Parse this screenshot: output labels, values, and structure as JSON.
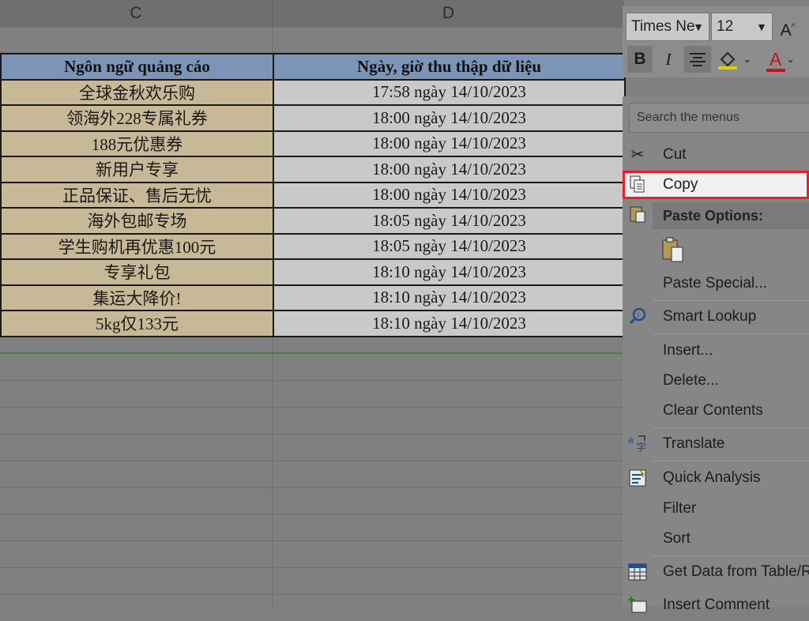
{
  "sheet": {
    "columns": [
      "C",
      "D"
    ],
    "header": [
      "Ngôn ngữ quảng cáo",
      "Ngày, giờ thu thập dữ liệu"
    ],
    "rows": [
      [
        "全球金秋欢乐购",
        "17:58 ngày 14/10/2023"
      ],
      [
        "领海外228专属礼券",
        "18:00 ngày 14/10/2023"
      ],
      [
        "188元优惠券",
        "18:00 ngày 14/10/2023"
      ],
      [
        "新用户专享",
        "18:00 ngày 14/10/2023"
      ],
      [
        "正品保证、售后无忧",
        "18:00 ngày 14/10/2023"
      ],
      [
        "海外包邮专场",
        "18:05 ngày 14/10/2023"
      ],
      [
        "学生购机再优惠100元",
        "18:05 ngày 14/10/2023"
      ],
      [
        "专享礼包",
        "18:10 ngày 14/10/2023"
      ],
      [
        "集运大降价!",
        "18:10 ngày 14/10/2023"
      ],
      [
        "5kg仅133元",
        "18:10 ngày 14/10/2023"
      ]
    ]
  },
  "toolbar": {
    "font_name": "Times Ne",
    "font_size": "12",
    "grow_font": "A",
    "bold": "B",
    "italic": "I",
    "font_color_letter": "A"
  },
  "menu": {
    "search_placeholder": "Search the menus",
    "cut": "Cut",
    "copy": "Copy",
    "paste_options": "Paste Options:",
    "paste_special": "Paste Special...",
    "smart_lookup": "Smart Lookup",
    "insert": "Insert...",
    "delete": "Delete...",
    "clear_contents": "Clear Contents",
    "translate": "Translate",
    "quick_analysis": "Quick Analysis",
    "filter": "Filter",
    "sort": "Sort",
    "get_data": "Get Data from Table/R",
    "insert_comment": "Insert Comment"
  },
  "colors": {
    "highlight_border": "#e5202a",
    "header_fill": "#7c94b8",
    "col_c_fill": "#c7b998",
    "col_d_fill": "#c9c9c9"
  }
}
